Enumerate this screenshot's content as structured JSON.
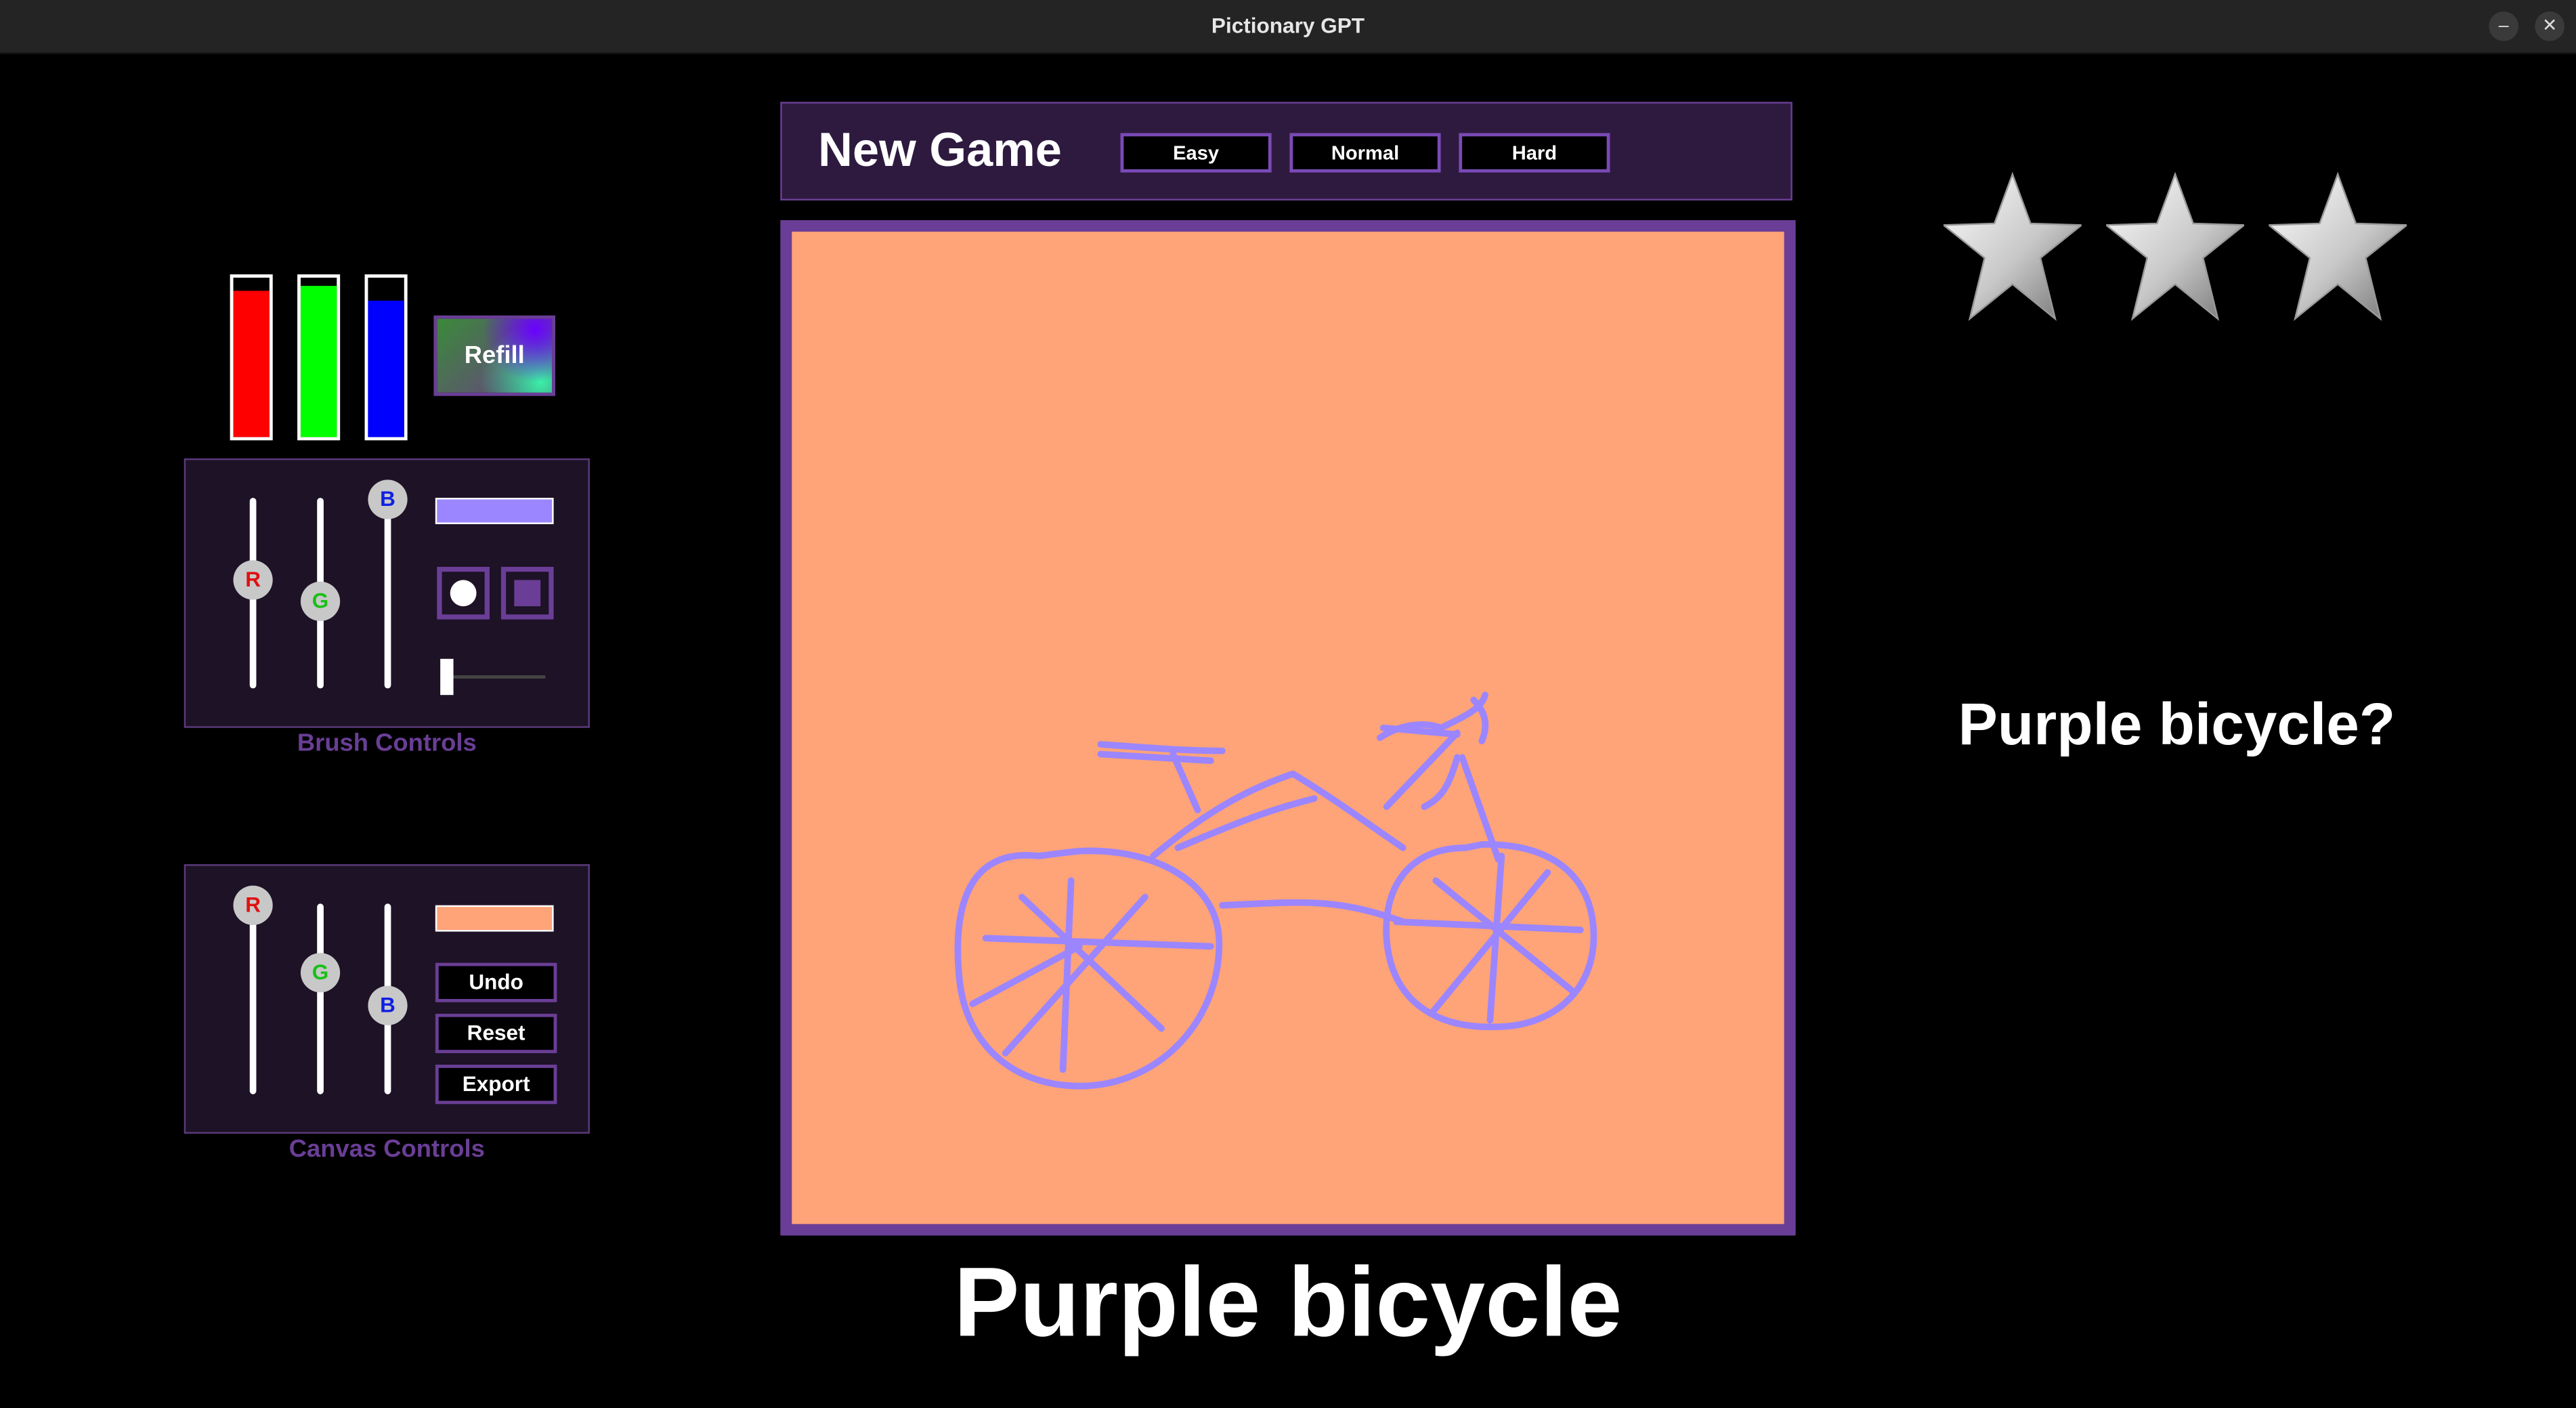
{
  "window": {
    "title": "Pictionary GPT",
    "minimize_glyph": "–",
    "close_glyph": "✕"
  },
  "header": {
    "title": "New Game",
    "difficulties": [
      "Easy",
      "Normal",
      "Hard"
    ]
  },
  "prompt": "Purple bicycle",
  "guess": "Purple bicycle?",
  "stars": {
    "total": 3,
    "icon": "star-icon"
  },
  "paint": {
    "refill_label": "Refill",
    "levels": {
      "red": 0.92,
      "green": 0.95,
      "blue": 0.86
    },
    "colors": {
      "red": "#ff0000",
      "green": "#00ff00",
      "blue": "#0000ff"
    }
  },
  "brush_controls": {
    "label": "Brush Controls",
    "slider_labels": [
      "R",
      "G",
      "B"
    ],
    "rgb_values": {
      "r": 150,
      "g": 120,
      "b": 255
    },
    "color_preview": "#9b86ff",
    "brush_size": 0.04
  },
  "canvas_controls": {
    "label": "Canvas Controls",
    "slider_labels": [
      "R",
      "G",
      "B"
    ],
    "rgb_values": {
      "r": 255,
      "g": 165,
      "b": 120
    },
    "color_preview": "#ffa378",
    "buttons": [
      "Undo",
      "Reset",
      "Export"
    ]
  },
  "colors": {
    "accent": "#6a3e96",
    "canvas_background": "#ffa378",
    "stroke": "#9b86ff",
    "panel_background": "#1e1226",
    "header_background": "#2e1a3f"
  }
}
